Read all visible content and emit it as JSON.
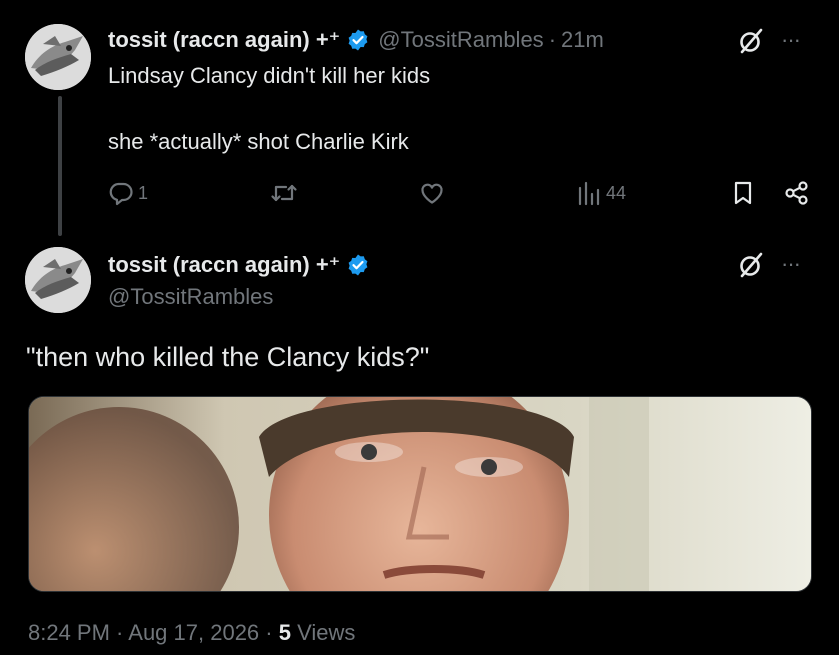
{
  "tweet1": {
    "display_name": "tossit (raccn again) +⁺",
    "handle": "@TossitRambles",
    "separator": "·",
    "time": "21m",
    "text_line1": "Lindsay Clancy didn't kill her kids",
    "text_line2": "she *actually* shot Charlie Kirk",
    "replies": "1",
    "views": "44",
    "more": "···"
  },
  "tweet2": {
    "display_name": "tossit (raccn again) +⁺",
    "handle": "@TossitRambles",
    "text": "\"then who killed the Clancy kids?\"",
    "more": "···",
    "timestamp": "8:24 PM · Aug 17, 2026 · ",
    "views_count": "5",
    "views_label": " Views"
  },
  "icons": {
    "verified": "verified-badge-icon",
    "grok": "grok-icon",
    "more": "more-icon",
    "reply": "reply-icon",
    "retweet": "retweet-icon",
    "like": "heart-icon",
    "views": "views-icon",
    "bookmark": "bookmark-icon",
    "share": "share-icon"
  },
  "colors": {
    "background": "#000000",
    "primary_text": "#e7e9ea",
    "secondary_text": "#71767b",
    "verified_blue": "#1d9bf0",
    "thread_line": "#3e4144"
  }
}
